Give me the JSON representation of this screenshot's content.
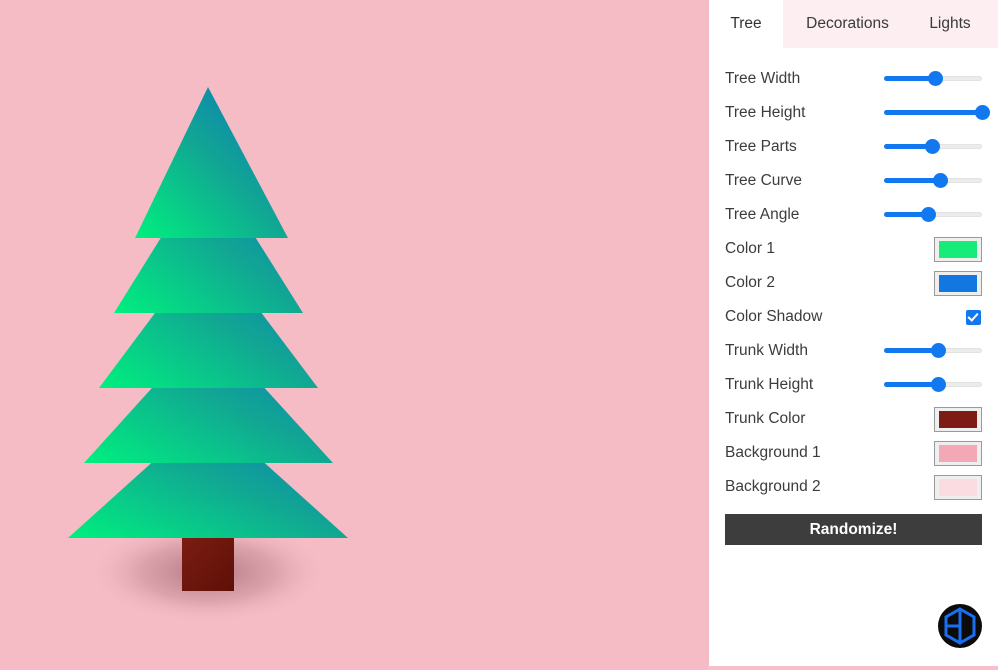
{
  "tabs": [
    {
      "id": "tree",
      "label": "Tree",
      "active": true
    },
    {
      "id": "decorations",
      "label": "Decorations",
      "active": false
    },
    {
      "id": "lights",
      "label": "Lights",
      "active": false
    }
  ],
  "controls": {
    "tree_width": {
      "label": "Tree Width",
      "type": "slider",
      "percent": 52
    },
    "tree_height": {
      "label": "Tree Height",
      "type": "slider",
      "percent": 100
    },
    "tree_parts": {
      "label": "Tree Parts",
      "type": "slider",
      "percent": 49
    },
    "tree_curve": {
      "label": "Tree Curve",
      "type": "slider",
      "percent": 57
    },
    "tree_angle": {
      "label": "Tree Angle",
      "type": "slider",
      "percent": 45
    },
    "color_1": {
      "label": "Color 1",
      "type": "color",
      "value": "#18ec78"
    },
    "color_2": {
      "label": "Color 2",
      "type": "color",
      "value": "#1277de"
    },
    "color_shadow": {
      "label": "Color Shadow",
      "type": "checkbox",
      "checked": true
    },
    "trunk_width": {
      "label": "Trunk Width",
      "type": "slider",
      "percent": 55
    },
    "trunk_height": {
      "label": "Trunk Height",
      "type": "slider",
      "percent": 55
    },
    "trunk_color": {
      "label": "Trunk Color",
      "type": "color",
      "value": "#7c1c14"
    },
    "background_1": {
      "label": "Background 1",
      "type": "color",
      "value": "#f3a8b5"
    },
    "background_2": {
      "label": "Background 2",
      "type": "color",
      "value": "#fbdde1"
    }
  },
  "randomize_button": {
    "label": "Randomize!"
  },
  "logo": {
    "name": "hexagon-h-logo",
    "circle_color": "#0b0b0b",
    "mark_color": "#1a6ff0"
  },
  "canvas": {
    "background_color": "#f6bcc5",
    "tree_gradient_start": "#18ec78",
    "tree_gradient_end": "#0f74c4",
    "trunk_color": "#7c1c14",
    "shadow_color": "#8b4a52",
    "layers": 5
  },
  "accent_color": "#1278ef"
}
